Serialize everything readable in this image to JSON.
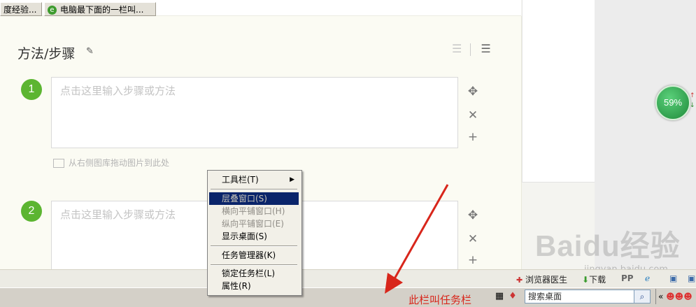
{
  "editor": {
    "section_title": "方法/步骤",
    "steps": [
      {
        "number": "1",
        "placeholder": "点击这里输入步骤或方法"
      },
      {
        "number": "2",
        "placeholder": "点击这里输入步骤或方法"
      }
    ],
    "image_hint": "从右侧图库拖动图片到此处"
  },
  "widget": {
    "gauge_value": "59%"
  },
  "watermark": {
    "brand": "Baidu经验",
    "url": "jingyan.baidu.com"
  },
  "tray_bar": {
    "browser_doctor": "浏览器医生",
    "download": "下载"
  },
  "taskbar": {
    "buttons": [
      "度经验...",
      "电脑最下面的一栏叫..."
    ],
    "annotation": "此栏叫任务栏",
    "search_text": "搜索桌面"
  },
  "context_menu": {
    "items": [
      {
        "label": "工具栏(T)",
        "state": "normal",
        "submenu": true
      },
      {
        "label": "层叠窗口(S)",
        "state": "highlighted"
      },
      {
        "label": "横向平铺窗口(H)",
        "state": "disabled"
      },
      {
        "label": "纵向平铺窗口(E)",
        "state": "disabled"
      },
      {
        "label": "显示桌面(S)",
        "state": "normal"
      },
      {
        "label": "任务管理器(K)",
        "state": "normal"
      },
      {
        "label": "锁定任务栏(L)",
        "state": "normal"
      },
      {
        "label": "属性(R)",
        "state": "normal"
      }
    ]
  },
  "colors": {
    "step_green": "#5cb531",
    "annotation_red": "#d8261b",
    "menu_highlight": "#0a246a"
  }
}
